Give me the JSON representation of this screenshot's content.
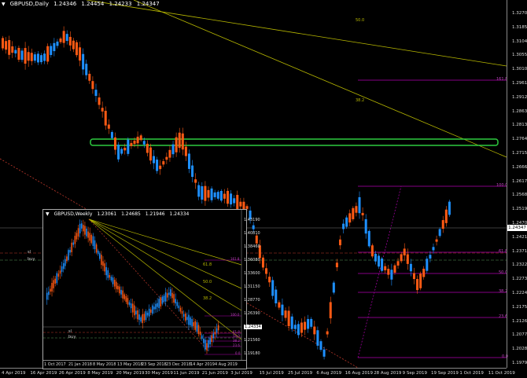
{
  "main_chart": {
    "symbol": "GBPUSD,Daily",
    "ohlc": [
      "1.24346",
      "1.24454",
      "1.24233",
      "1.24347"
    ],
    "price_ticks": [
      "1.32700",
      "1.31850",
      "1.31040",
      "1.30550",
      "1.30100",
      "1.29610",
      "1.29120",
      "1.28630",
      "1.28130",
      "1.27640",
      "1.27150",
      "1.26660",
      "1.26170",
      "1.25680",
      "1.25190",
      "1.24700",
      "1.24210",
      "1.23710",
      "1.23220",
      "1.22730",
      "1.22240",
      "1.21750",
      "1.21260",
      "1.20770",
      "1.20280",
      "1.19790"
    ],
    "current_price": "1.24347",
    "time_ticks": [
      "4 Apr 2019",
      "16 Apr 2019",
      "26 Apr 2019",
      "8 May 2019",
      "20 May 2019",
      "30 May 2019",
      "11 Jun 2019",
      "21 Jun 2019",
      "3 Jul 2019",
      "15 Jul 2019",
      "25 Jul 2019",
      "6 Aug 2019",
      "16 Aug 2019",
      "28 Aug 2019",
      "9 Sep 2019",
      "19 Sep 2019",
      "1 Oct 2019",
      "11 Oct 2019"
    ],
    "fan_labels": [
      "50.0",
      "38.2"
    ],
    "fib_labels": [
      "161.8",
      "100.0",
      "61.8",
      "50.0",
      "38.2",
      "23.6",
      "0.0"
    ],
    "line_labels": [
      "sl",
      "buy"
    ],
    "colors": {
      "bull": "#1e90ff",
      "bear": "#ff5a14",
      "fib": "#b000b0",
      "fan": "#b8b800",
      "zone": "#2ecc40",
      "trend": "#c0392b"
    }
  },
  "weekly_chart": {
    "symbol": "GBPUSD,Weekly",
    "ohlc": [
      "1.23061",
      "1.24685",
      "1.21946",
      "1.24334"
    ],
    "price_ticks": [
      "1.43190",
      "1.40810",
      "1.38460",
      "1.36080",
      "1.33600",
      "1.31150",
      "1.28770",
      "1.26390",
      "1.24334",
      "1.21560",
      "1.19180"
    ],
    "time_ticks": [
      "1 Oct 2017",
      "21 Jan 2018",
      "8 May 2018",
      "13 May 2018",
      "23 Sep 2018",
      "23 Dec 2018",
      "14 Apr 2019",
      "4 Aug 2019"
    ],
    "fan_labels": [
      "61.8",
      "50.0",
      "38.2"
    ],
    "fib_labels": [
      "161.8",
      "100.0",
      "61.8",
      "50.0",
      "38.2",
      "23.6",
      "0.0"
    ],
    "line_labels": [
      "sl",
      "buy"
    ]
  }
}
